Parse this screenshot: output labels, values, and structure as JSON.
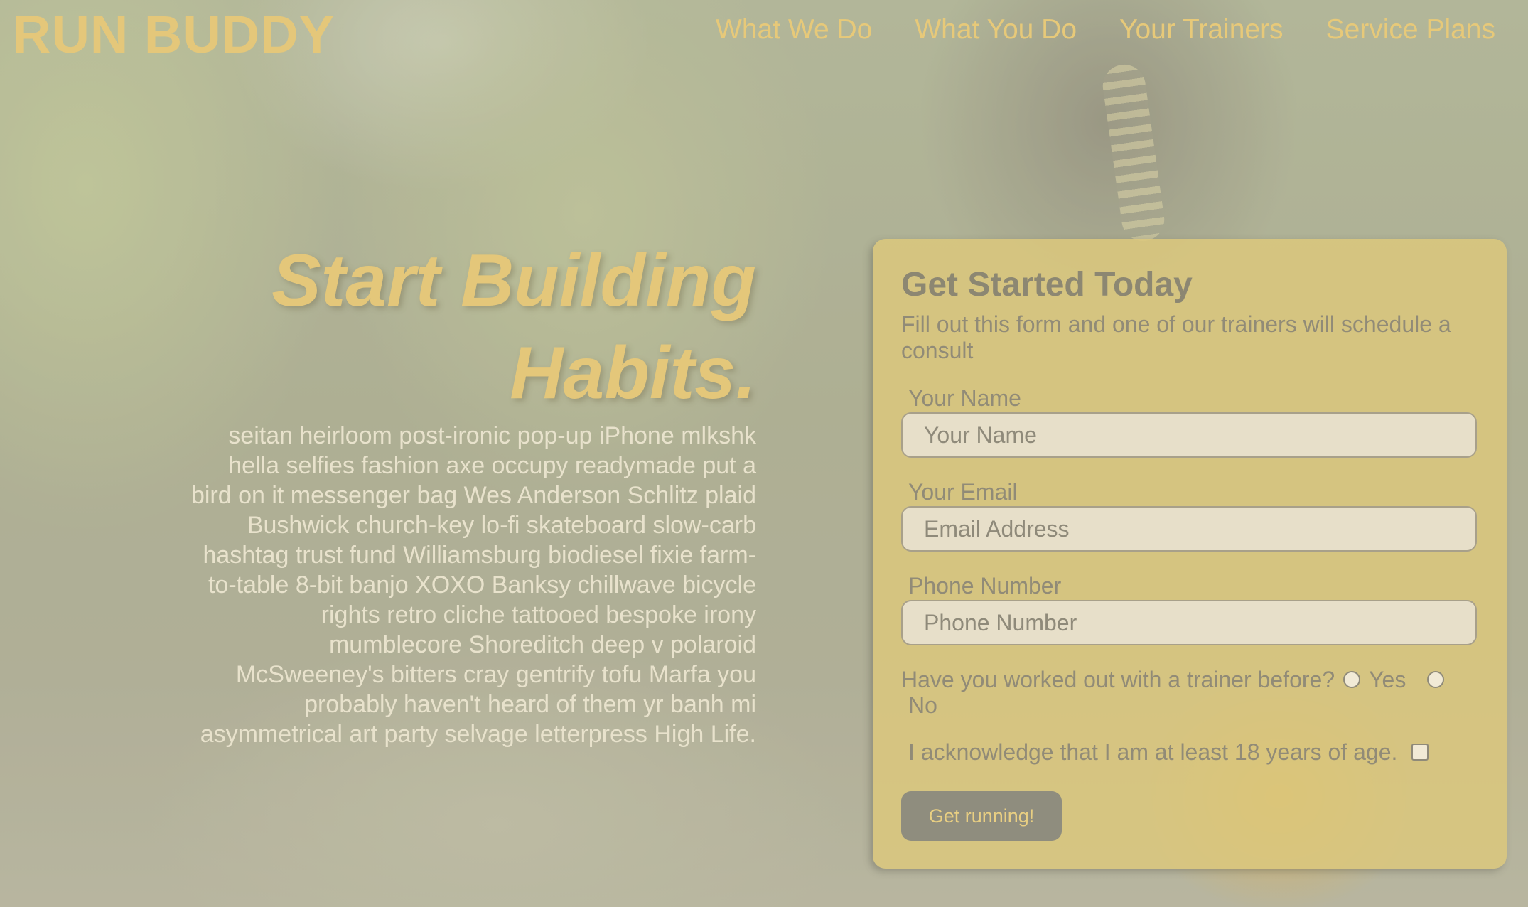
{
  "header": {
    "logo": "RUN BUDDY",
    "nav": [
      "What We Do",
      "What You Do",
      "Your Trainers",
      "Service Plans"
    ]
  },
  "hero": {
    "title": "Start Building Habits.",
    "text": "seitan heirloom post-ironic pop-up iPhone mlkshk hella selfies fashion axe occupy readymade put a bird on it messenger bag Wes Anderson Schlitz plaid Bushwick church-key lo-fi skateboard slow-carb hashtag trust fund Williamsburg biodiesel fixie farm-to-table 8-bit banjo XOXO Banksy chillwave bicycle rights retro cliche tattooed bespoke irony mumblecore Shoreditch deep v polaroid McSweeney's bitters cray gentrify tofu Marfa you probably haven't heard of them yr banh mi asymmetrical art party selvage letterpress High Life."
  },
  "form": {
    "title": "Get Started Today",
    "subtitle": "Fill out this form and one of our trainers will schedule a consult",
    "name_label": "Your Name",
    "name_placeholder": "Your Name",
    "email_label": "Your Email",
    "email_placeholder": "Email Address",
    "phone_label": "Phone Number",
    "phone_placeholder": "Phone Number",
    "trainer_question": "Have you worked out with a trainer before?",
    "yes_label": "Yes",
    "no_label": "No",
    "age_ack": "I acknowledge that I am at least 18 years of age.",
    "submit_label": "Get running!"
  },
  "colors": {
    "accent": "#e4c77a",
    "card": "#dcc87d",
    "button": "#8f8d7e"
  }
}
